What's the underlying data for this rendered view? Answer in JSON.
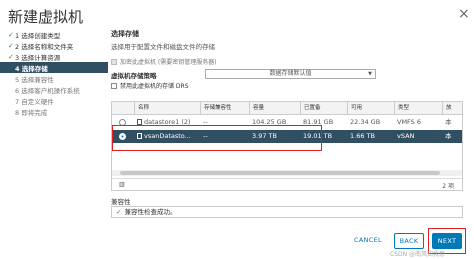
{
  "window": {
    "title": "新建虚拟机",
    "close_glyph": "×"
  },
  "steps": [
    {
      "label": "1 选择创建类型",
      "state": "done"
    },
    {
      "label": "2 选择名称和文件夹",
      "state": "done"
    },
    {
      "label": "3 选择计算资源",
      "state": "done"
    },
    {
      "label": "4 选择存储",
      "state": "active"
    },
    {
      "label": "5 选择兼容性",
      "state": "todo"
    },
    {
      "label": "6 选择客户机操作系统",
      "state": "todo"
    },
    {
      "label": "7 自定义硬件",
      "state": "todo"
    },
    {
      "label": "8 即将完成",
      "state": "todo"
    }
  ],
  "section": {
    "title": "选择存储",
    "subtitle": "选择用于配置文件和磁盘文件的存储",
    "encrypt_checkbox": "加密此虚拟机 (需要密钥管理服务器)",
    "policy_label": "虚拟机存储策略",
    "policy_value": "数据存储默认值",
    "drs_checkbox": "禁用此虚拟机的存储 DRS"
  },
  "table": {
    "columns": [
      "名称",
      "存储兼容性",
      "容量",
      "已置备",
      "可用",
      "类型",
      "放"
    ],
    "rows": [
      {
        "name": "datastore1 (2)",
        "compat": "--",
        "capacity": "104.25 GB",
        "provisioned": "81.91 GB",
        "free": "22.34 GB",
        "type": "VMFS 6",
        "extra": "本",
        "selected": false
      },
      {
        "name": "vsanDatasto...",
        "compat": "--",
        "capacity": "3.97 TB",
        "provisioned": "19.01 TB",
        "free": "1.66 TB",
        "type": "vSAN",
        "extra": "本",
        "selected": true
      }
    ],
    "footer_count": "2 项"
  },
  "compatibility": {
    "label": "兼容性",
    "message": "兼容性检查成功。"
  },
  "buttons": {
    "cancel": "CANCEL",
    "back": "BACK",
    "next": "NEXT"
  },
  "watermark": "CSDN @南风知我意"
}
